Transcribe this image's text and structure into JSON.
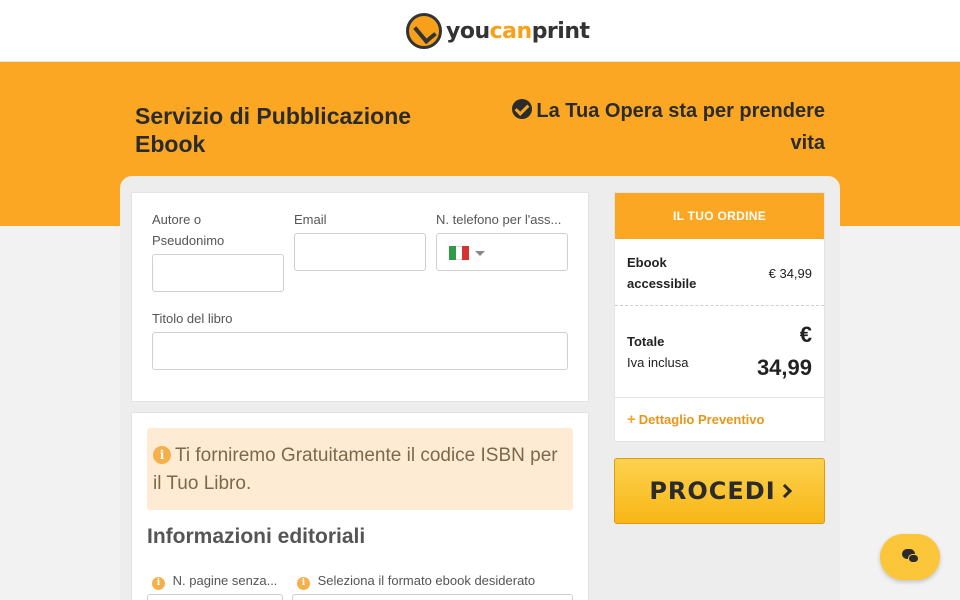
{
  "brand": {
    "logo_you": "you",
    "logo_can": "can",
    "logo_print": "print"
  },
  "hero": {
    "title": "Servizio di Pubblicazione Ebook",
    "tagline": "La Tua Opera sta per prendere vita"
  },
  "form": {
    "author_label": "Autore o Pseudonimo",
    "author_value": "",
    "email_label": "Email",
    "email_value": "",
    "phone_label": "N. telefono per l'ass...",
    "phone_value": "",
    "title_label": "Titolo del libro",
    "title_value": ""
  },
  "notice": {
    "text": "Ti forniremo Gratuitamente il codice ISBN per il Tuo Libro."
  },
  "editorial": {
    "heading": "Informazioni editoriali",
    "pages_label": "N. pagine senza...",
    "format_label": "Seleziona il formato ebook desiderato"
  },
  "order": {
    "header": "IL TUO ORDINE",
    "item_name": "Ebook accessibile",
    "item_price": "€ 34,99",
    "total_label": "Totale",
    "vat_label": "Iva inclusa",
    "total_currency": "€",
    "total_amount": "34,99",
    "detail_link": "Dettaglio Preventivo"
  },
  "actions": {
    "procedi": "PROCEDI"
  },
  "colors": {
    "accent": "#fba723",
    "button": "#fdd24f",
    "notice_bg": "#fdebd3"
  },
  "icons": [
    "check-circle-icon",
    "italy-flag-icon",
    "chevron-down-icon",
    "info-icon",
    "plus-icon",
    "chevron-right-icon",
    "chat-icon"
  ]
}
